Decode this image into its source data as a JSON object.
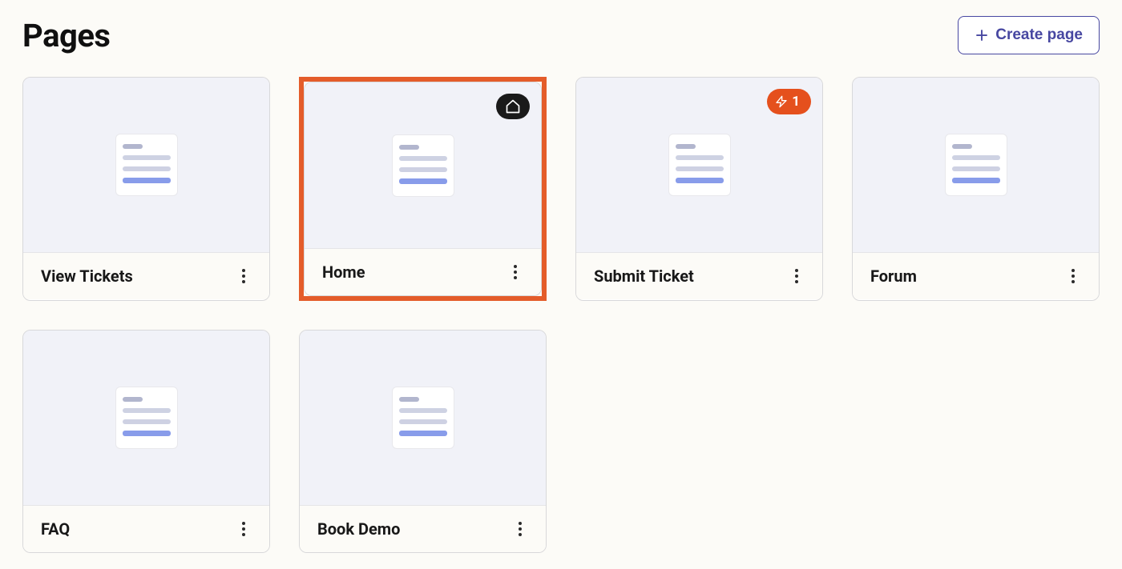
{
  "header": {
    "title": "Pages",
    "create_button": "Create page"
  },
  "cards": [
    {
      "title": "View Tickets",
      "selected": false,
      "badge": null
    },
    {
      "title": "Home",
      "selected": true,
      "badge": {
        "type": "home"
      }
    },
    {
      "title": "Submit Ticket",
      "selected": false,
      "badge": {
        "type": "bolt",
        "count": "1"
      }
    },
    {
      "title": "Forum",
      "selected": false,
      "badge": null
    },
    {
      "title": "FAQ",
      "selected": false,
      "badge": null
    },
    {
      "title": "Book Demo",
      "selected": false,
      "badge": null
    }
  ]
}
